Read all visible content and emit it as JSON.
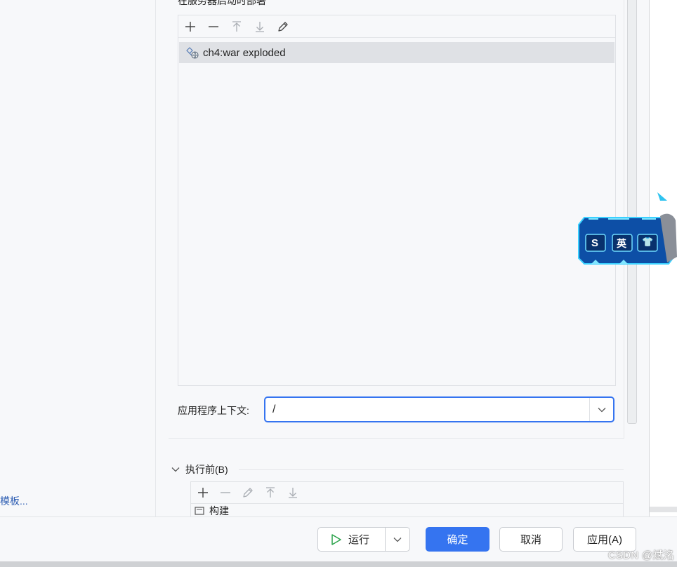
{
  "deployment": {
    "section_title": "在服务器启动时部署",
    "toolbar": [
      "add-icon",
      "remove-icon",
      "move-up-icon",
      "move-down-icon",
      "edit-icon"
    ],
    "items": [
      {
        "label": "ch4:war exploded",
        "icon": "artifact-web-icon"
      }
    ]
  },
  "context": {
    "label": "应用程序上下文:",
    "value": "/"
  },
  "before_launch": {
    "title": "执行前(B)",
    "toolbar": [
      "add-icon",
      "remove-icon",
      "edit-icon",
      "move-up-icon",
      "move-down-icon"
    ],
    "items": [
      {
        "label": "构建"
      }
    ]
  },
  "left": {
    "template_link": "模板..."
  },
  "footer": {
    "run_label": "运行",
    "ok_label": "确定",
    "cancel_label": "取消",
    "apply_label": "应用(A)"
  },
  "overlay": {
    "widget_labels": [
      "S",
      "英",
      "👕"
    ],
    "watermark": "CSDN @斌洺"
  },
  "colors": {
    "accent": "#3574f0",
    "selection": "#dfe1e5",
    "run_green": "#2aa24a"
  }
}
